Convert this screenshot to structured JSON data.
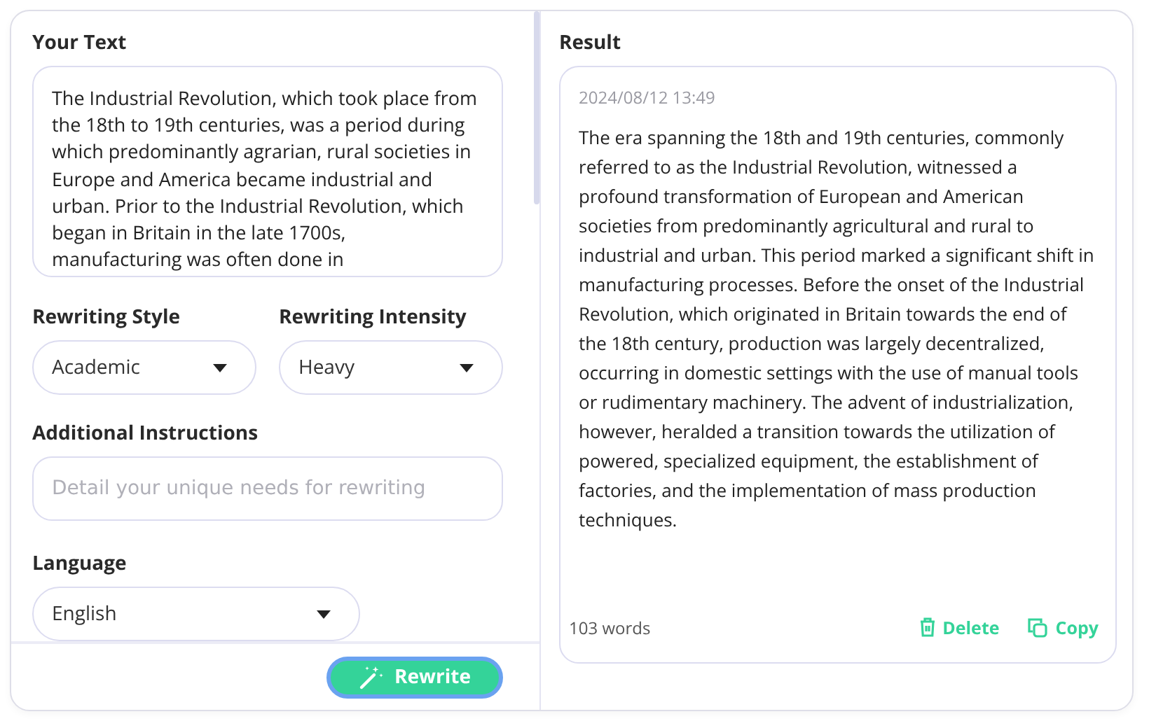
{
  "input": {
    "label": "Your Text",
    "text": "The Industrial Revolution, which took place from the 18th to 19th centuries, was a period during which predominantly agrarian, rural societies in Europe and America became industrial and urban. Prior to the Industrial Revolution, which began in Britain in the late 1700s, manufacturing was often done in"
  },
  "selects": [
    {
      "label": "Rewriting Style",
      "value": "Academic"
    },
    {
      "label": "Rewriting Intensity",
      "value": "Heavy"
    }
  ],
  "instructions": {
    "label": "Additional Instructions",
    "placeholder": "Detail your unique needs for rewriting"
  },
  "language": {
    "label": "Language",
    "value": "English"
  },
  "rewrite_button": "Rewrite",
  "result": {
    "label": "Result",
    "timestamp": "2024/08/12 13:49",
    "text": "The era spanning the 18th and 19th centuries, commonly referred to as the Industrial Revolution, witnessed a profound transformation of European and American societies from predominantly agricultural and rural to industrial and urban. This period marked a significant shift in manufacturing processes. Before the onset of the Industrial Revolution, which originated in Britain towards the end of the 18th century, production was largely decentralized, occurring in domestic settings with the use of manual tools or rudimentary machinery. The advent of industrialization, however, heralded a transition towards the utilization of powered, specialized equipment, the establishment of factories, and the implementation of mass production techniques.",
    "word_count": "103 words",
    "actions": [
      {
        "kind": "delete",
        "label": "Delete"
      },
      {
        "kind": "copy",
        "label": "Copy"
      }
    ]
  }
}
